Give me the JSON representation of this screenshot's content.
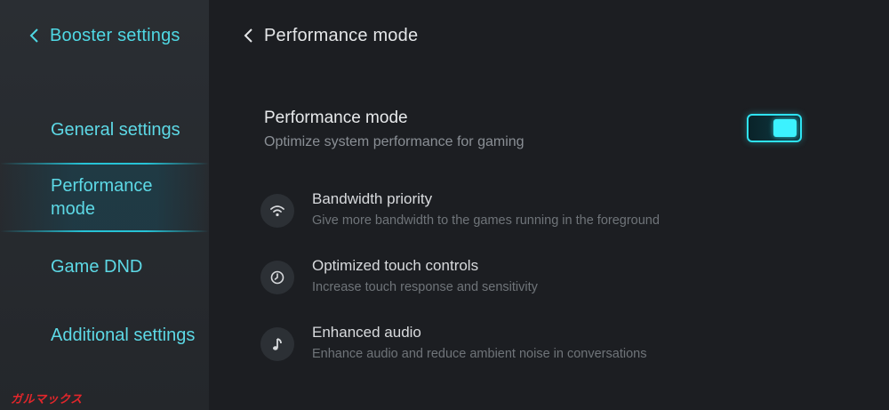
{
  "sidebar": {
    "back_title": "Booster settings",
    "items": [
      {
        "label": "General settings",
        "active": false
      },
      {
        "label": "Performance mode",
        "active": true
      },
      {
        "label": "Game DND",
        "active": false
      },
      {
        "label": "Additional settings",
        "active": false
      }
    ]
  },
  "main": {
    "back_title": "Performance mode",
    "performance": {
      "title": "Performance mode",
      "subtitle": "Optimize system performance for gaming",
      "toggle_on": true
    },
    "features": [
      {
        "icon": "wifi-icon",
        "title": "Bandwidth priority",
        "subtitle": "Give more bandwidth to the games running in the foreground"
      },
      {
        "icon": "clock-icon",
        "title": "Optimized touch controls",
        "subtitle": "Increase touch response and sensitivity"
      },
      {
        "icon": "music-note-icon",
        "title": "Enhanced audio",
        "subtitle": "Enhance audio and reduce ambient noise in conversations"
      }
    ]
  },
  "watermark": "ガルマックス",
  "colors": {
    "accent": "#4fd8e4",
    "toggle": "#3cf2ff",
    "background": "#1c1e22",
    "sidebar": "#2a2e33"
  }
}
